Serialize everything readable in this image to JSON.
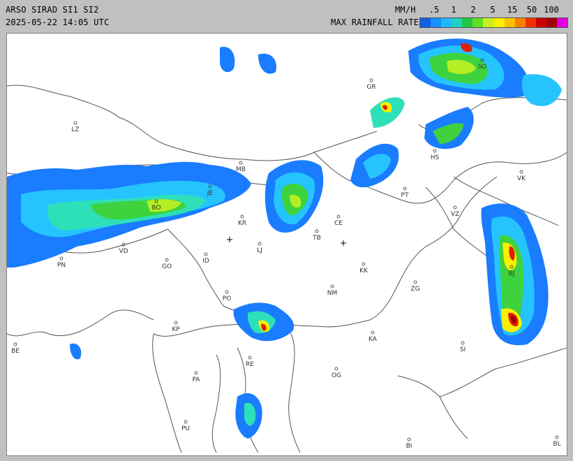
{
  "header": {
    "title": "ARSO SIRAD SI1 SI2",
    "timestamp": "2025-05-22 14:05 UTC",
    "units": "MM/H",
    "legend_title": "MAX RAINFALL RATE"
  },
  "legend": {
    "tick_labels": [
      ".5",
      "1",
      "2",
      "5",
      "15",
      "50",
      "100"
    ],
    "colors": [
      "#1060e0",
      "#1890ff",
      "#1fb8ff",
      "#20d0c0",
      "#20c840",
      "#60e020",
      "#c8f020",
      "#f8f000",
      "#f8c000",
      "#f88000",
      "#f03000",
      "#c80000",
      "#a00000",
      "#e000e0"
    ]
  },
  "cities": [
    {
      "code": "LZ"
    },
    {
      "code": "GR"
    },
    {
      "code": "SO"
    },
    {
      "code": "VK"
    },
    {
      "code": "PT"
    },
    {
      "code": "VZ"
    },
    {
      "code": "KR"
    },
    {
      "code": "CE"
    },
    {
      "code": "TB"
    },
    {
      "code": "LJ"
    },
    {
      "code": "BO"
    },
    {
      "code": "JE"
    },
    {
      "code": "VD"
    },
    {
      "code": "PN"
    },
    {
      "code": "GO"
    },
    {
      "code": "ID"
    },
    {
      "code": "KK"
    },
    {
      "code": "NM"
    },
    {
      "code": "ZG"
    },
    {
      "code": "BJ"
    },
    {
      "code": "PO"
    },
    {
      "code": "KP"
    },
    {
      "code": "KA"
    },
    {
      "code": "SI"
    },
    {
      "code": "RE"
    },
    {
      "code": "OG"
    },
    {
      "code": "PA"
    },
    {
      "code": "BE"
    },
    {
      "code": "PU"
    },
    {
      "code": "BI"
    },
    {
      "code": "BL"
    },
    {
      "code": "MB"
    },
    {
      "code": "HS"
    }
  ],
  "radar_colors": {
    "light": "#1a7cff",
    "cyan": "#25c4ff",
    "teal": "#2ee0b8",
    "green": "#3ed23e",
    "yellow_green": "#b4ee24",
    "yellow": "#f8f000",
    "orange": "#f8a000",
    "red": "#e02000",
    "dark_red": "#a00000"
  }
}
